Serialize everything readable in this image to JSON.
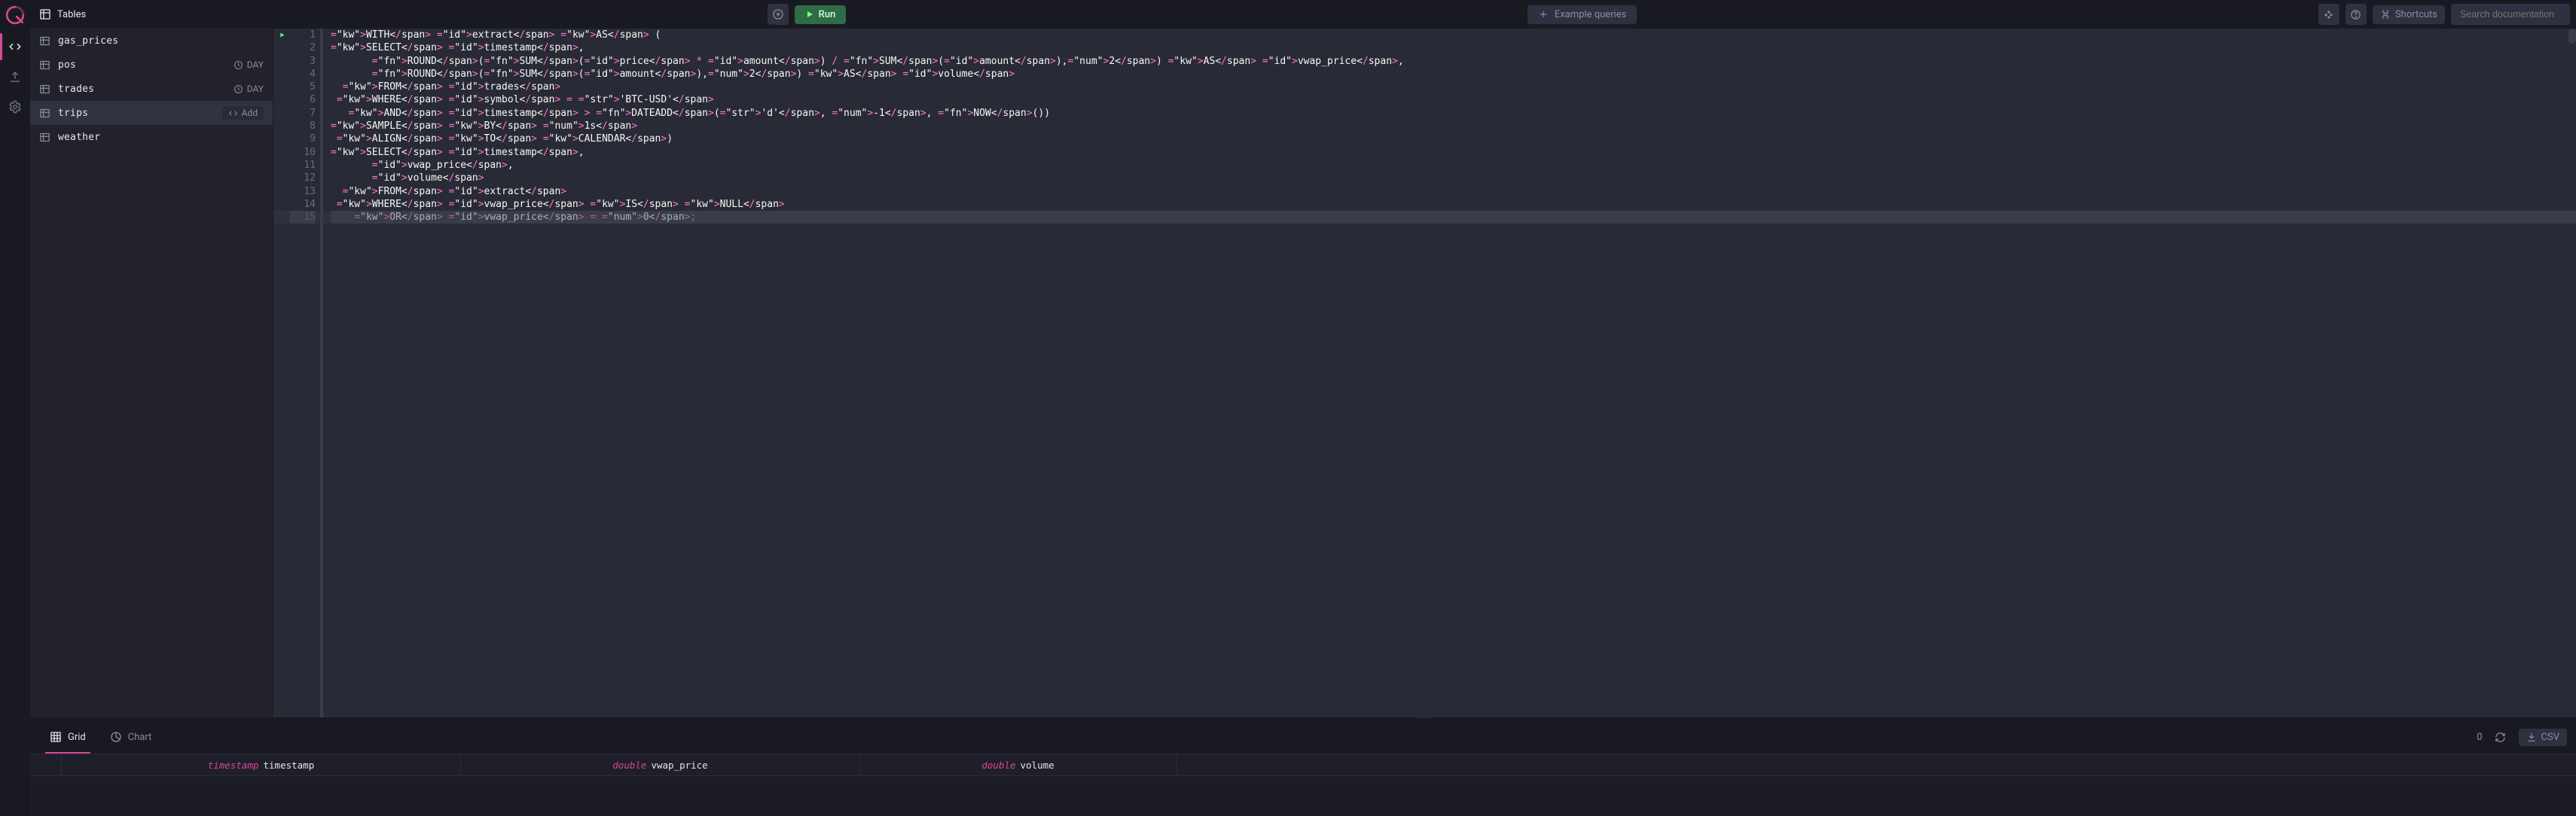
{
  "topbar": {
    "tables_label": "Tables",
    "run_label": "Run",
    "example_label": "Example queries",
    "shortcuts_label": "Shortcuts",
    "search_placeholder": "Search documentation"
  },
  "tables": [
    {
      "name": "gas_prices",
      "partition": null,
      "selected": false,
      "add": false
    },
    {
      "name": "pos",
      "partition": "DAY",
      "selected": false,
      "add": false
    },
    {
      "name": "trades",
      "partition": "DAY",
      "selected": false,
      "add": false
    },
    {
      "name": "trips",
      "partition": null,
      "selected": true,
      "add": true,
      "add_label": "Add"
    },
    {
      "name": "weather",
      "partition": null,
      "selected": false,
      "add": false
    }
  ],
  "editor": {
    "line_count": 15,
    "active_line": 15,
    "code_lines": [
      "WITH extract AS (",
      "SELECT timestamp,",
      "       ROUND(SUM(price * amount) / SUM(amount),2) AS vwap_price,",
      "       ROUND(SUM(amount),2) AS volume",
      "  FROM trades",
      " WHERE symbol = 'BTC-USD'",
      "   AND timestamp > DATEADD('d', -1, NOW())",
      "SAMPLE BY 1s",
      " ALIGN TO CALENDAR)",
      "SELECT timestamp,",
      "       vwap_price,",
      "       volume",
      "  FROM extract",
      " WHERE vwap_price IS NULL",
      "    OR vwap_price = 0;"
    ]
  },
  "results": {
    "tabs": {
      "grid": "Grid",
      "chart": "Chart"
    },
    "active_tab": "grid",
    "row_count": "0",
    "csv_label": "CSV",
    "columns": [
      {
        "type": "timestamp",
        "name": "timestamp"
      },
      {
        "type": "double",
        "name": "vwap_price"
      },
      {
        "type": "double",
        "name": "volume"
      }
    ]
  }
}
